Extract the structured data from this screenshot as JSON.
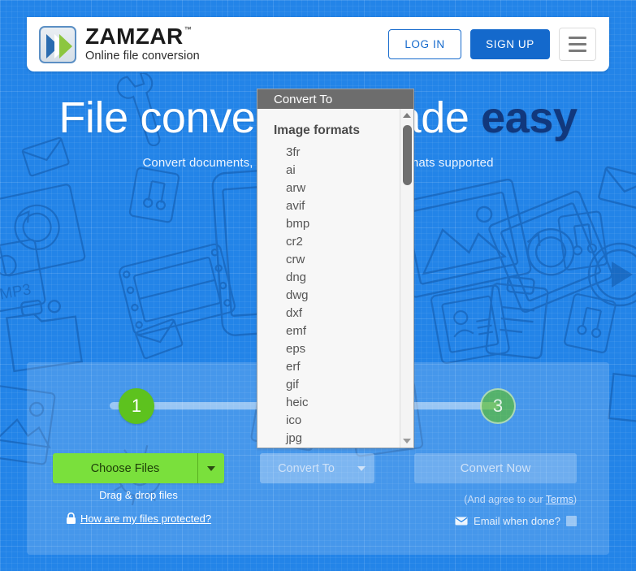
{
  "header": {
    "brand_name": "ZAMZAR",
    "brand_tm": "™",
    "tagline": "Online file conversion",
    "login_label": "LOG IN",
    "signup_label": "SIGN UP",
    "menu_label": "menu"
  },
  "hero": {
    "title_part1": "File conversion m",
    "title_part2": "ade ",
    "title_accent": "easy",
    "subtitle": "Convert documents, images, audio and video formats supported"
  },
  "steps": [
    {
      "number": "1",
      "state": "active"
    },
    {
      "number": "3",
      "state": "inactive"
    }
  ],
  "converter": {
    "choose_files_label": "Choose Files",
    "convert_to_label": "Convert To",
    "convert_now_label": "Convert Now",
    "drag_drop_text": "Drag & drop files",
    "protected_link": "How are my files protected?",
    "terms_prefix": "(And agree to our ",
    "terms_link": "Terms",
    "terms_suffix": ")",
    "email_label": "Email when done?",
    "email_checked": false
  },
  "dropdown": {
    "header_label": "Convert To",
    "group_label": "Image formats",
    "items": [
      "3fr",
      "ai",
      "arw",
      "avif",
      "bmp",
      "cr2",
      "crw",
      "dng",
      "dwg",
      "dxf",
      "emf",
      "eps",
      "erf",
      "gif",
      "heic",
      "ico",
      "jpg"
    ]
  },
  "colors": {
    "page_blue": "#2384e8",
    "brand_blue": "#1469cc",
    "accent_navy": "#11387d",
    "green_primary": "#7ae03c",
    "step_green": "#5dc21e",
    "dropdown_header_gray": "#6d6d6d",
    "white": "#ffffff"
  }
}
